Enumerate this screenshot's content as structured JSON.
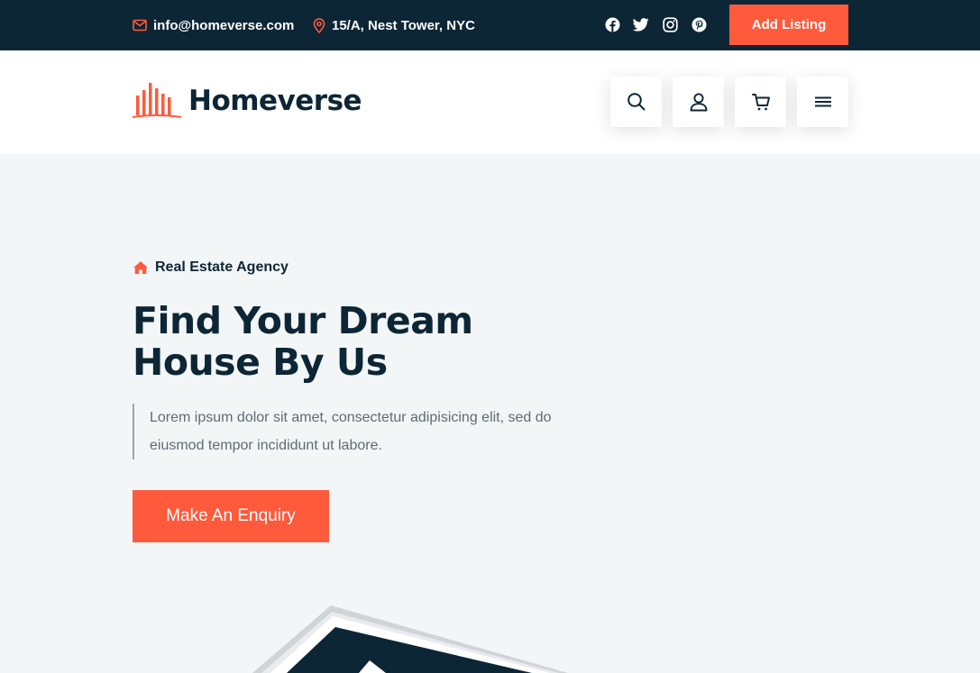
{
  "topbar": {
    "email": "info@homeverse.com",
    "address": "15/A, Nest Tower, NYC",
    "socials": [
      "facebook-icon",
      "twitter-icon",
      "instagram-icon",
      "pinterest-icon"
    ],
    "add_listing_label": "Add Listing"
  },
  "header": {
    "logo_text": "Homeverse",
    "buttons": [
      "search-icon",
      "user-icon",
      "cart-icon",
      "menu-icon"
    ]
  },
  "hero": {
    "tag": "Real Estate Agency",
    "title": "Find Your Dream House By Us",
    "text": "Lorem ipsum dolor sit amet, consectetur adipisicing elit, sed do eiusmod tempor incididunt ut labore.",
    "button_label": "Make An Enquiry"
  },
  "colors": {
    "accent": "#ff5a3c",
    "dark": "#0d2636",
    "background": "#f3f6f7"
  }
}
